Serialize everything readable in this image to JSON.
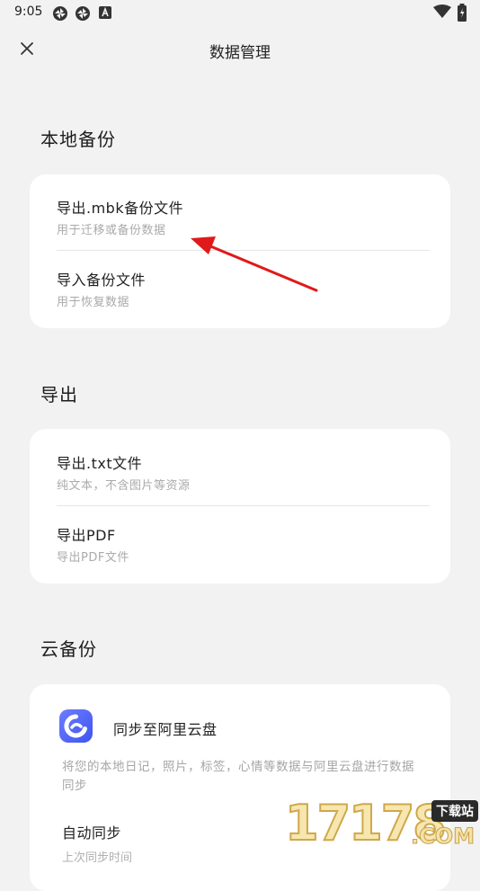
{
  "status_bar": {
    "time": "9:05",
    "notification_icons": [
      "aperture-icon",
      "aperture-icon",
      "a-badge-icon"
    ],
    "system_icons": [
      "wifi-icon",
      "battery-charging-icon"
    ]
  },
  "app_bar": {
    "close_icon": "close-icon",
    "title": "数据管理"
  },
  "sections": {
    "local_backup": {
      "title": "本地备份",
      "items": [
        {
          "title": "导出.mbk备份文件",
          "subtitle": "用于迁移或备份数据"
        },
        {
          "title": "导入备份文件",
          "subtitle": "用于恢复数据"
        }
      ]
    },
    "export": {
      "title": "导出",
      "items": [
        {
          "title": "导出.txt文件",
          "subtitle": "纯文本，不含图片等资源"
        },
        {
          "title": "导出PDF",
          "subtitle": "导出PDF文件"
        }
      ]
    },
    "cloud_backup": {
      "title": "云备份",
      "provider_name": "同步至阿里云盘",
      "provider_icon": "aliyun-drive-logo-icon",
      "description": "将您的本地日记，照片，标签，心情等数据与阿里云盘进行数据同步",
      "auto_sync_label": "自动同步",
      "auto_sync_sub": "上次同步时间"
    }
  },
  "annotation": {
    "arrow_color": "#e0191b"
  },
  "watermark": {
    "number": "17178",
    "badge": "下载站",
    "domain": ".COM"
  },
  "colors": {
    "background": "#f2f2f2",
    "card": "#ffffff",
    "accent_logo": "#4a5cf5"
  }
}
